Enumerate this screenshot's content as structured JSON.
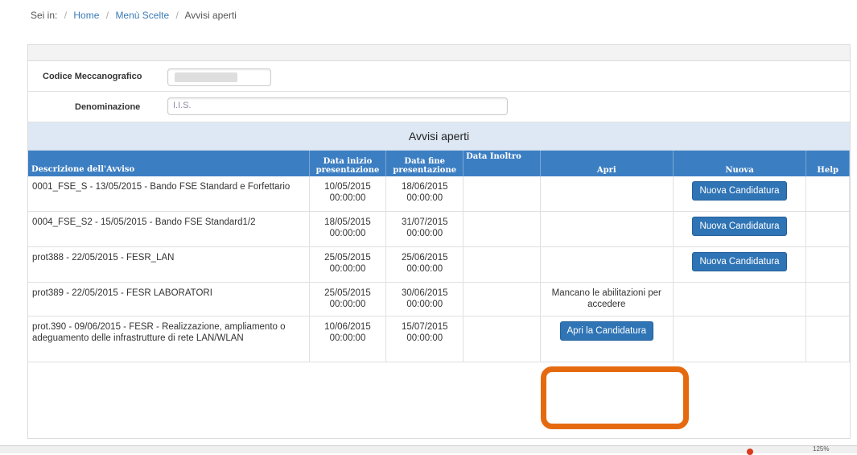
{
  "breadcrumb": {
    "prefix": "Sei in:",
    "items": [
      "Home",
      "Menù Scelte",
      "Avvisi aperti"
    ]
  },
  "form": {
    "codice_label": "Codice Meccanografico",
    "codice_value": "",
    "denominazione_label": "Denominazione",
    "denominazione_value": "I.I.S."
  },
  "section_title": "Avvisi aperti",
  "table": {
    "headers": {
      "descrizione": "Descrizione dell'Avviso",
      "data_inizio": "Data inizio presentazione",
      "data_fine": "Data fine presentazione",
      "data_inoltro": "Data Inoltro",
      "apri": "Apri",
      "nuova": "Nuova",
      "help": "Help"
    },
    "rows": [
      {
        "descrizione": "0001_FSE_S - 13/05/2015 - Bando FSE Standard e Forfettario",
        "inizio": "10/05/2015 00:00:00",
        "fine": "18/06/2015 00:00:00",
        "inoltro": "",
        "apri": "",
        "nuova": "Nuova Candidatura"
      },
      {
        "descrizione": "0004_FSE_S2 - 15/05/2015 - Bando FSE Standard1/2",
        "inizio": "18/05/2015 00:00:00",
        "fine": "31/07/2015 00:00:00",
        "inoltro": "",
        "apri": "",
        "nuova": "Nuova Candidatura"
      },
      {
        "descrizione": "prot388 - 22/05/2015 - FESR_LAN",
        "inizio": "25/05/2015 00:00:00",
        "fine": "25/06/2015 00:00:00",
        "inoltro": "",
        "apri": "",
        "nuova": "Nuova Candidatura"
      },
      {
        "descrizione": "prot389 - 22/05/2015 - FESR LABORATORI",
        "inizio": "25/05/2015 00:00:00",
        "fine": "30/06/2015 00:00:00",
        "inoltro": "",
        "apri_text": "Mancano le abilitazioni per accedere",
        "nuova": ""
      },
      {
        "descrizione": "prot.390 - 09/06/2015 - FESR - Realizzazione, ampliamento o adeguamento delle infrastrutture di rete LAN/WLAN",
        "inizio": "10/06/2015 00:00:00",
        "fine": "15/07/2015 00:00:00",
        "inoltro": "",
        "apri_button": "Apri la Candidatura",
        "nuova": ""
      }
    ]
  },
  "statusbar": {
    "zoom": "125%"
  },
  "colors": {
    "header_blue": "#3c7ec2",
    "button_blue": "#2f74b5",
    "highlight_orange": "#e56a0f",
    "section_bg": "#dde8f4"
  }
}
